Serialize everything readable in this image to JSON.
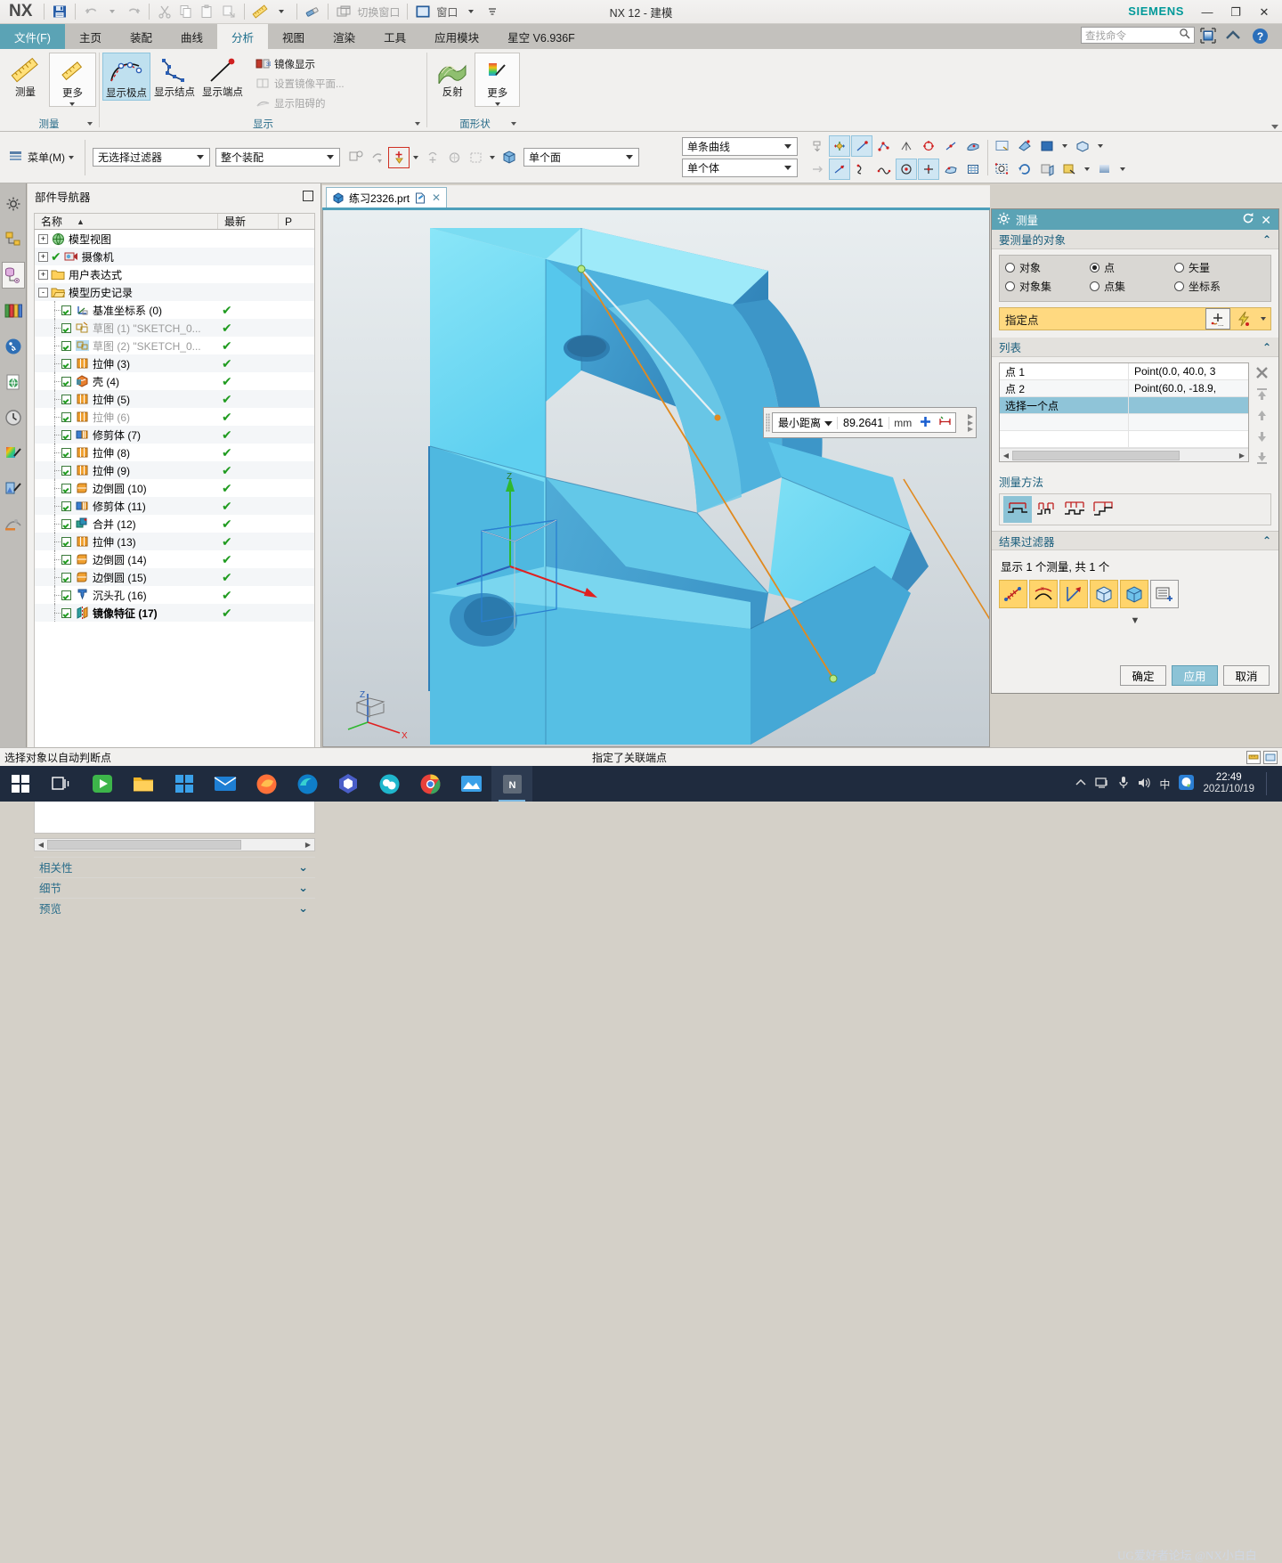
{
  "titlebar": {
    "logo": "NX",
    "title": "NX 12 - 建模",
    "brand": "SIEMENS",
    "quick_access": [
      {
        "name": "save-icon",
        "label": ""
      },
      {
        "name": "undo-icon",
        "label": ""
      },
      {
        "name": "redo-icon",
        "label": ""
      },
      {
        "name": "cut-icon",
        "label": ""
      },
      {
        "name": "copy-icon",
        "label": ""
      },
      {
        "name": "paste-icon",
        "label": ""
      },
      {
        "name": "paste-special-icon",
        "label": ""
      },
      {
        "name": "measure-icon",
        "label": ""
      },
      {
        "name": "eraser-icon",
        "label": ""
      },
      {
        "name": "switch-window-icon",
        "label": "切换窗口"
      },
      {
        "name": "window-icon",
        "label": "窗口"
      }
    ],
    "min": "—",
    "max": "❐",
    "close": "✕"
  },
  "ribbon_tabs": [
    {
      "label": "文件(F)",
      "state": "file"
    },
    {
      "label": "主页",
      "state": "normal"
    },
    {
      "label": "装配",
      "state": "normal"
    },
    {
      "label": "曲线",
      "state": "normal"
    },
    {
      "label": "分析",
      "state": "active"
    },
    {
      "label": "视图",
      "state": "normal"
    },
    {
      "label": "渲染",
      "state": "normal"
    },
    {
      "label": "工具",
      "state": "normal"
    },
    {
      "label": "应用模块",
      "state": "normal"
    },
    {
      "label": "星空 V6.936F",
      "state": "normal"
    }
  ],
  "search": {
    "placeholder": "查找命令"
  },
  "ribbon": {
    "groups": [
      {
        "label": "测量",
        "has_dropdown": true,
        "buttons": [
          {
            "label": "测量",
            "icon": "ruler-icon",
            "state": "normal"
          },
          {
            "label": "更多",
            "icon": "ruler-more-icon",
            "state": "box",
            "caret": true
          }
        ]
      },
      {
        "label": "显示",
        "has_dropdown": true,
        "buttons": [
          {
            "label": "显示极点",
            "icon": "show-poles-icon",
            "state": "selected"
          },
          {
            "label": "显示结点",
            "icon": "show-knots-icon",
            "state": "normal"
          },
          {
            "label": "显示端点",
            "icon": "show-endpoints-icon",
            "state": "normal"
          }
        ],
        "small_buttons": [
          {
            "label": "镜像显示",
            "icon": "mirror-display-icon",
            "disabled": false
          },
          {
            "label": "设置镜像平面...",
            "icon": "set-mirror-plane-icon",
            "disabled": true
          },
          {
            "label": "显示阻碍的",
            "icon": "show-obstructed-icon",
            "disabled": true
          }
        ]
      },
      {
        "label": "面形状",
        "has_dropdown": true,
        "buttons": [
          {
            "label": "反射",
            "icon": "reflection-icon",
            "state": "normal"
          },
          {
            "label": "更多",
            "icon": "face-analysis-more-icon",
            "state": "box",
            "caret": true
          }
        ]
      }
    ]
  },
  "toolbar2": {
    "menu_label": "菜单(M)",
    "selection_filter": "无选择过滤器",
    "scope": "整个装配",
    "face_rule": "单个面",
    "curve_rule": "单条曲线",
    "body_rule": "单个体"
  },
  "resource_bar": {
    "items": [
      {
        "name": "assembly-navigator-icon"
      },
      {
        "name": "constraint-navigator-icon"
      },
      {
        "name": "part-navigator-icon",
        "active": true
      },
      {
        "name": "reuse-library-icon"
      },
      {
        "name": "hd3d-tools-icon"
      },
      {
        "name": "web-browser-icon"
      },
      {
        "name": "history-icon"
      },
      {
        "name": "system-materials-icon"
      },
      {
        "name": "system-scenes-icon"
      },
      {
        "name": "role-icon"
      }
    ]
  },
  "navigator": {
    "title": "部件导航器",
    "columns": [
      "名称",
      "最新",
      "P"
    ],
    "tree": [
      {
        "indent": 0,
        "expander": "+",
        "icon": "model-views-icon",
        "label": "模型视图",
        "grey": false,
        "check": null,
        "updated": false,
        "bold": false
      },
      {
        "indent": 0,
        "expander": "+",
        "icon": "camera-icon",
        "label": "摄像机",
        "grey": false,
        "check": null,
        "updated": false,
        "bold": false,
        "leading_check": true
      },
      {
        "indent": 0,
        "expander": "+",
        "icon": "folder-icon",
        "label": "用户表达式",
        "grey": false,
        "check": null,
        "updated": false,
        "bold": false
      },
      {
        "indent": 0,
        "expander": "-",
        "icon": "folder-open-icon",
        "label": "模型历史记录",
        "grey": false,
        "check": null,
        "updated": false,
        "bold": false
      },
      {
        "indent": 1,
        "expander": "",
        "icon": "datum-csys-icon",
        "label": "基准坐标系 (0)",
        "grey": false,
        "check": true,
        "updated": true,
        "bold": false
      },
      {
        "indent": 1,
        "expander": "",
        "icon": "sketch-icon",
        "label": "草图 (1) \"SKETCH_0...",
        "grey": true,
        "check": true,
        "updated": true,
        "bold": false
      },
      {
        "indent": 1,
        "expander": "",
        "icon": "sketch-active-icon",
        "label": "草图 (2) \"SKETCH_0...",
        "grey": true,
        "check": true,
        "updated": true,
        "bold": false
      },
      {
        "indent": 1,
        "expander": "",
        "icon": "extrude-icon",
        "label": "拉伸 (3)",
        "grey": false,
        "check": true,
        "updated": true,
        "bold": false
      },
      {
        "indent": 1,
        "expander": "",
        "icon": "shell-icon",
        "label": "壳 (4)",
        "grey": false,
        "check": true,
        "updated": true,
        "bold": false
      },
      {
        "indent": 1,
        "expander": "",
        "icon": "extrude-icon",
        "label": "拉伸 (5)",
        "grey": false,
        "check": true,
        "updated": true,
        "bold": false
      },
      {
        "indent": 1,
        "expander": "",
        "icon": "extrude-icon",
        "label": "拉伸 (6)",
        "grey": true,
        "check": true,
        "updated": true,
        "bold": false
      },
      {
        "indent": 1,
        "expander": "",
        "icon": "trim-body-icon",
        "label": "修剪体 (7)",
        "grey": false,
        "check": true,
        "updated": true,
        "bold": false
      },
      {
        "indent": 1,
        "expander": "",
        "icon": "extrude-icon",
        "label": "拉伸 (8)",
        "grey": false,
        "check": true,
        "updated": true,
        "bold": false
      },
      {
        "indent": 1,
        "expander": "",
        "icon": "extrude-icon",
        "label": "拉伸 (9)",
        "grey": false,
        "check": true,
        "updated": true,
        "bold": false
      },
      {
        "indent": 1,
        "expander": "",
        "icon": "edge-blend-icon",
        "label": "边倒圆 (10)",
        "grey": false,
        "check": true,
        "updated": true,
        "bold": false
      },
      {
        "indent": 1,
        "expander": "",
        "icon": "trim-body-icon",
        "label": "修剪体 (11)",
        "grey": false,
        "check": true,
        "updated": true,
        "bold": false
      },
      {
        "indent": 1,
        "expander": "",
        "icon": "unite-icon",
        "label": "合并 (12)",
        "grey": false,
        "check": true,
        "updated": true,
        "bold": false
      },
      {
        "indent": 1,
        "expander": "",
        "icon": "extrude-icon",
        "label": "拉伸 (13)",
        "grey": false,
        "check": true,
        "updated": true,
        "bold": false
      },
      {
        "indent": 1,
        "expander": "",
        "icon": "edge-blend-icon",
        "label": "边倒圆 (14)",
        "grey": false,
        "check": true,
        "updated": true,
        "bold": false
      },
      {
        "indent": 1,
        "expander": "",
        "icon": "edge-blend-icon",
        "label": "边倒圆 (15)",
        "grey": false,
        "check": true,
        "updated": true,
        "bold": false
      },
      {
        "indent": 1,
        "expander": "",
        "icon": "counterbore-hole-icon",
        "label": "沉头孔 (16)",
        "grey": false,
        "check": true,
        "updated": true,
        "bold": false
      },
      {
        "indent": 1,
        "expander": "",
        "icon": "mirror-feature-icon",
        "label": "镜像特征 (17)",
        "grey": false,
        "check": true,
        "updated": true,
        "bold": true
      }
    ],
    "collapsed_sections": [
      {
        "label": "相关性"
      },
      {
        "label": "细节"
      },
      {
        "label": "预览"
      }
    ]
  },
  "document_tab": {
    "filename": "练习2326.prt"
  },
  "callout": {
    "type": "最小距离",
    "value": "89.2641",
    "unit": "mm"
  },
  "measure_dialog": {
    "title": "测量",
    "sections": {
      "objects": {
        "header": "要测量的对象",
        "radios": [
          {
            "label": "对象",
            "checked": false
          },
          {
            "label": "点",
            "checked": true
          },
          {
            "label": "矢量",
            "checked": false
          },
          {
            "label": "对象集",
            "checked": false
          },
          {
            "label": "点集",
            "checked": false
          },
          {
            "label": "坐标系",
            "checked": false
          }
        ],
        "point_row_label": "指定点"
      },
      "list": {
        "header": "列表",
        "rows": [
          {
            "name": "点 1",
            "value": "Point(0.0, 40.0, 3",
            "selected": false
          },
          {
            "name": "点 2",
            "value": "Point(60.0, -18.9,",
            "selected": false
          },
          {
            "name": "选择一个点",
            "value": "",
            "selected": true
          },
          {
            "name": "",
            "value": "",
            "selected": false
          },
          {
            "name": "",
            "value": "",
            "selected": false
          }
        ],
        "side_buttons": [
          "delete-icon",
          "move-top-icon",
          "move-up-icon",
          "move-down-icon",
          "move-bottom-icon"
        ]
      },
      "method": {
        "header": "测量方法",
        "options": [
          {
            "name": "method-minimum-icon",
            "selected": true
          },
          {
            "name": "method-point-to-point-icon",
            "selected": false
          },
          {
            "name": "method-maximum-icon",
            "selected": false
          },
          {
            "name": "method-custom-icon",
            "selected": false
          }
        ]
      },
      "filter": {
        "header": "结果过滤器",
        "status": "显示 1 个测量, 共 1 个",
        "buttons": [
          {
            "name": "distance-filter-icon"
          },
          {
            "name": "angle-filter-icon"
          },
          {
            "name": "vector-filter-icon"
          },
          {
            "name": "volume-filter-icon"
          },
          {
            "name": "body-filter-icon"
          },
          {
            "name": "add-list-icon"
          }
        ]
      }
    },
    "buttons": {
      "ok": "确定",
      "apply": "应用",
      "cancel": "取消"
    }
  },
  "status_bar": {
    "left": "选择对象以自动判断点",
    "right": "指定了关联端点"
  },
  "taskbar": {
    "start": "start-icon",
    "apps": [
      {
        "name": "task-view-icon"
      },
      {
        "name": "media-player-icon"
      },
      {
        "name": "file-explorer-icon"
      },
      {
        "name": "store-icon"
      },
      {
        "name": "mail-icon"
      },
      {
        "name": "firefox-icon"
      },
      {
        "name": "edge-icon"
      },
      {
        "name": "browser-icon"
      },
      {
        "name": "wechat-icon"
      },
      {
        "name": "chrome-icon"
      },
      {
        "name": "photos-icon"
      },
      {
        "name": "nx-icon",
        "active": true
      }
    ],
    "tray": [
      {
        "name": "show-hidden-icons-icon"
      },
      {
        "name": "network-icon"
      },
      {
        "name": "microphone-icon"
      },
      {
        "name": "volume-icon"
      },
      {
        "name": "ime-icon",
        "label": "中"
      },
      {
        "name": "qq-icon"
      }
    ],
    "clock": "22:49",
    "date": "2021/10/19",
    "watermark": "UG爱好者论坛 @NX小白白"
  }
}
